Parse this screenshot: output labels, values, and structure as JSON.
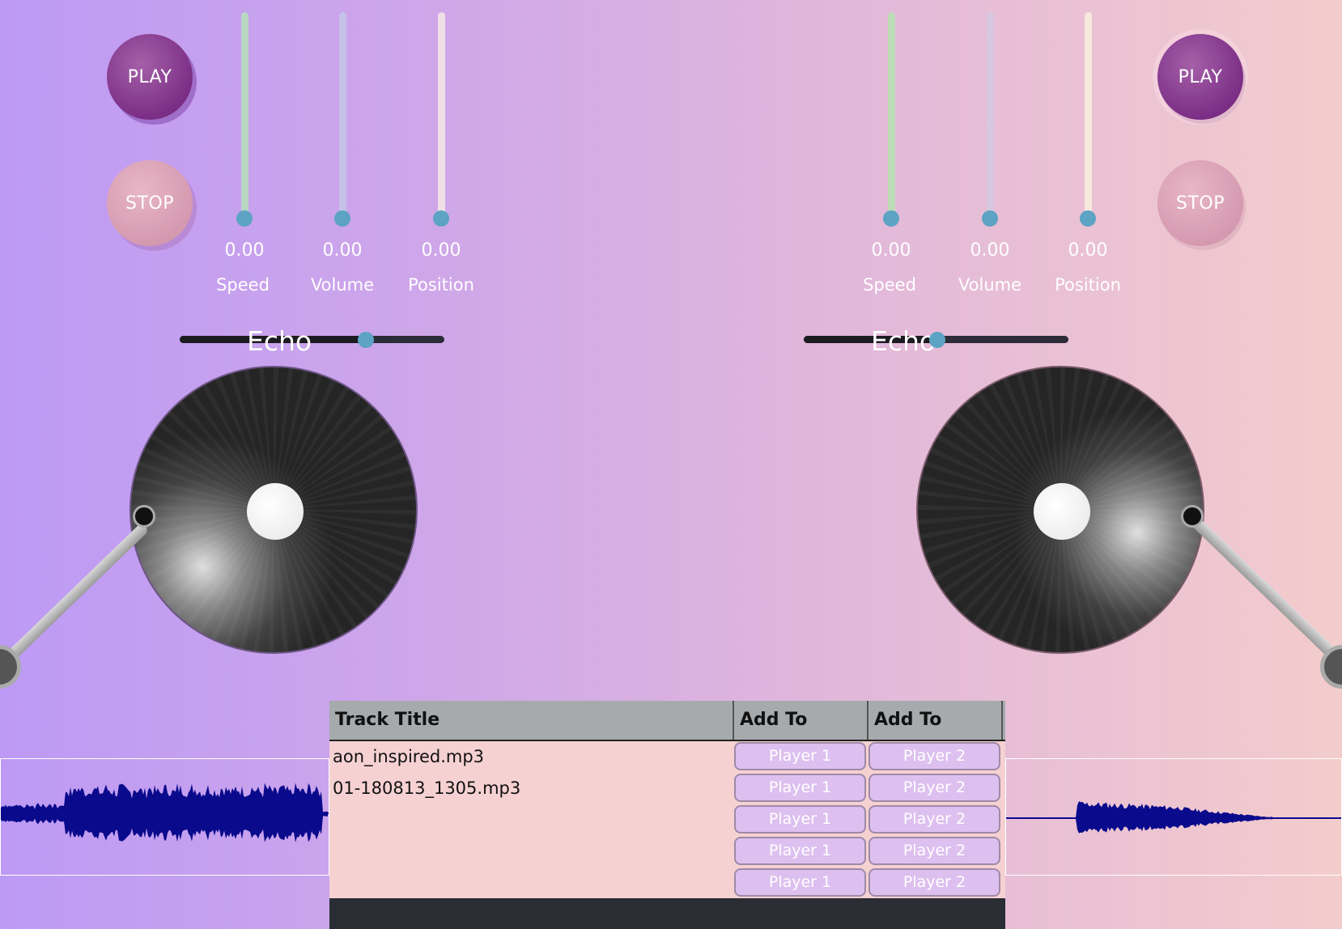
{
  "decks": [
    {
      "play_label": "PLAY",
      "stop_label": "STOP",
      "sliders": [
        {
          "label": "Speed",
          "value_text": "0.00",
          "value": 0.0,
          "track_color": "#b7d7c2"
        },
        {
          "label": "Volume",
          "value_text": "0.00",
          "value": 0.0,
          "track_color": "#c5c2ea"
        },
        {
          "label": "Position",
          "value_text": "0.00",
          "value": 0.0,
          "track_color": "#f0dfe8"
        }
      ],
      "echo": {
        "label": "Echo",
        "value": 0.7
      }
    },
    {
      "play_label": "PLAY",
      "stop_label": "STOP",
      "sliders": [
        {
          "label": "Speed",
          "value_text": "0.00",
          "value": 0.0,
          "track_color": "#bfdcb9"
        },
        {
          "label": "Volume",
          "value_text": "0.00",
          "value": 0.0,
          "track_color": "#d6c8df"
        },
        {
          "label": "Position",
          "value_text": "0.00",
          "value": 0.0,
          "track_color": "#f6e8dc"
        }
      ],
      "echo": {
        "label": "Echo",
        "value": 0.5
      }
    }
  ],
  "playlist": {
    "headers": [
      "Track Title",
      "Add To",
      "Add To"
    ],
    "tracks": [
      "aon_inspired.mp3",
      "01-180813_1305.mp3"
    ],
    "rows": [
      {
        "p1": "Player 1",
        "p2": "Player 2"
      },
      {
        "p1": "Player 1",
        "p2": "Player 2"
      },
      {
        "p1": "Player 1",
        "p2": "Player 2"
      },
      {
        "p1": "Player 1",
        "p2": "Player 2"
      },
      {
        "p1": "Player 1",
        "p2": "Player 2"
      }
    ]
  },
  "colors": {
    "play_button": "#7c2f86",
    "stop_button": "#d59ab0",
    "slider_thumb": "#5da3c3",
    "waveform": "#0a0a8c",
    "table_bg": "#f6d1d2",
    "table_header": "#a7aaad"
  }
}
